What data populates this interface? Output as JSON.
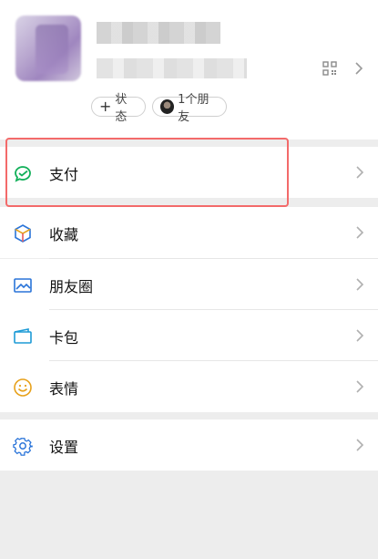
{
  "profile": {
    "status_label": "状态",
    "friends_label": "1个朋友"
  },
  "menu": {
    "pay": "支付",
    "favorites": "收藏",
    "moments": "朋友圈",
    "cards": "卡包",
    "stickers": "表情",
    "settings": "设置"
  },
  "colors": {
    "pay_icon": "#12b05a",
    "highlight": "#f36a6a",
    "moments_icon": "#2a74d9",
    "cards_icon": "#1e9bd6",
    "stickers_icon": "#e7a11b",
    "settings_icon": "#2a74d9"
  },
  "icons": {
    "qr": "qr-code-icon",
    "pay": "wechat-pay-icon",
    "favorites": "cube-icon",
    "moments": "picture-icon",
    "cards": "wallet-icon",
    "stickers": "smile-icon",
    "settings": "gear-icon"
  }
}
